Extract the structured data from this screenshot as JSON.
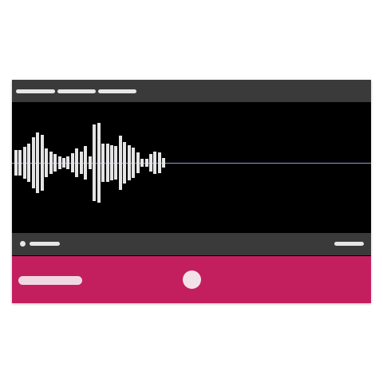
{
  "recorder": {
    "tabs": [
      {
        "id": "tab-1"
      },
      {
        "id": "tab-2"
      },
      {
        "id": "tab-3"
      }
    ],
    "waveform": {
      "color": "#e4e4e4",
      "baseline_color": "#7e9fd6",
      "amplitudes": [
        0.2,
        0.2,
        0.25,
        0.3,
        0.4,
        0.48,
        0.44,
        0.22,
        0.18,
        0.14,
        0.1,
        0.08,
        0.1,
        0.15,
        0.22,
        0.18,
        0.26,
        0.1,
        0.6,
        0.62,
        0.3,
        0.3,
        0.28,
        0.26,
        0.42,
        0.32,
        0.28,
        0.24,
        0.16,
        0.06,
        0.06,
        0.14,
        0.18,
        0.16,
        0.08
      ]
    },
    "status": {
      "indicator_color": "#e6e6e6"
    },
    "controls": {
      "panel_color": "#c31f5f",
      "record_button_color": "#f3e1e9"
    }
  }
}
